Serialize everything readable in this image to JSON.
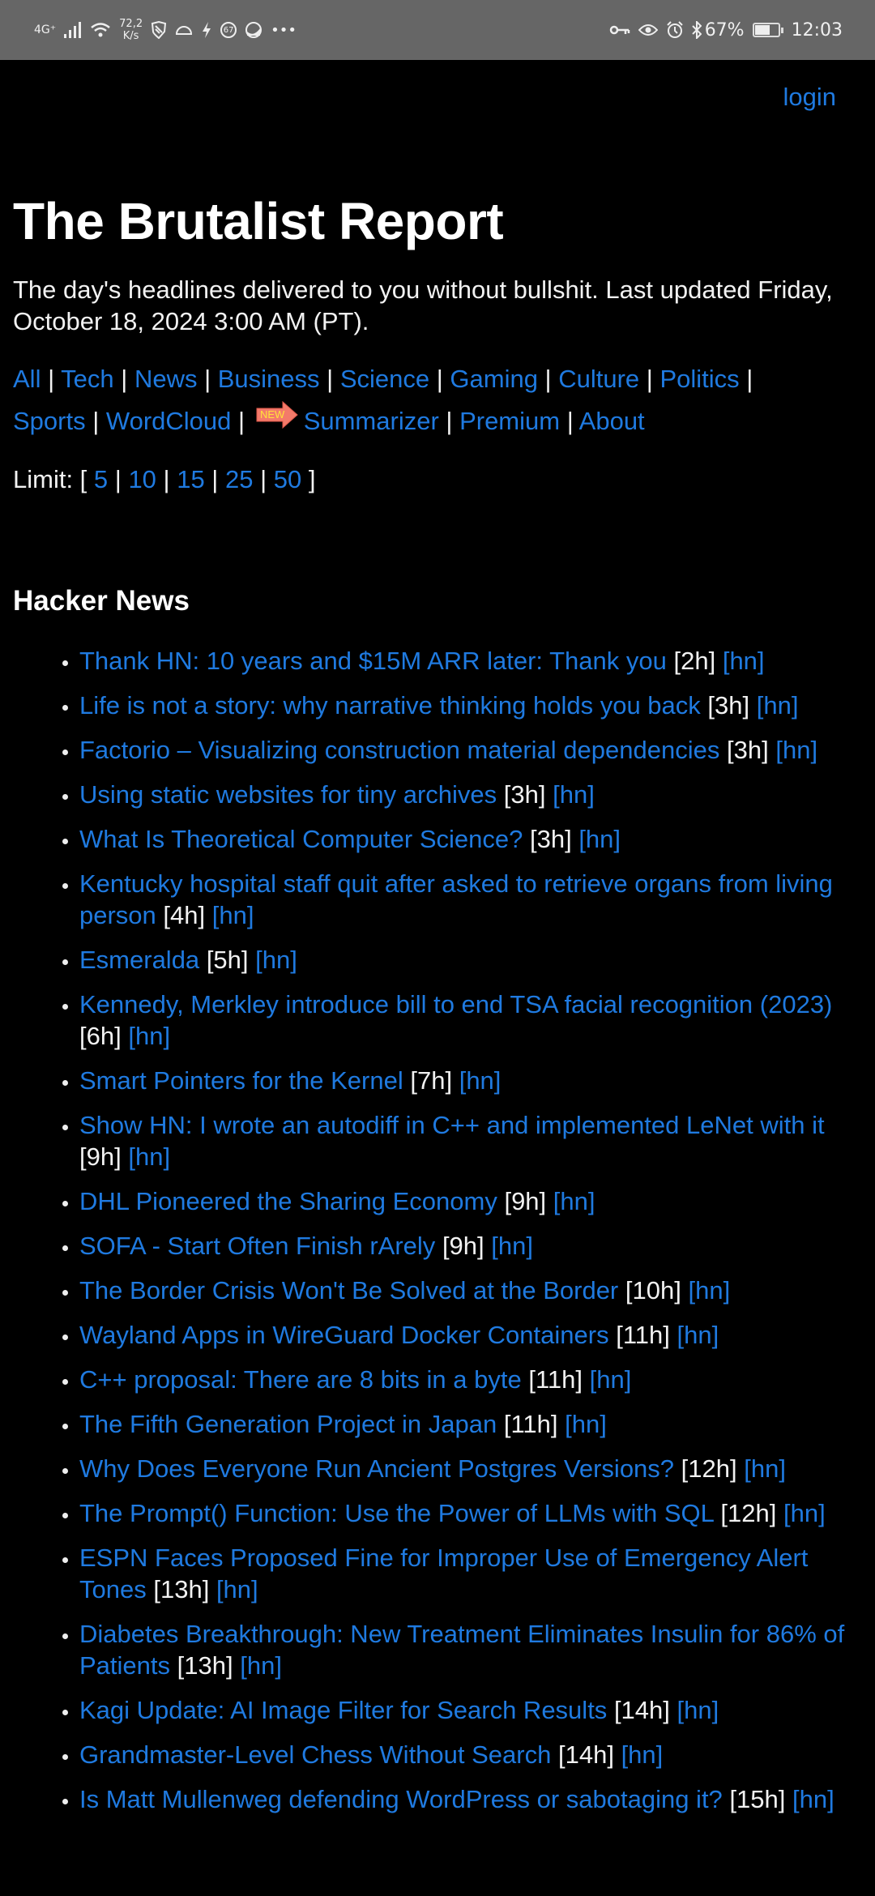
{
  "status_bar": {
    "network": "4G⁺",
    "net_speed_value": "72,2",
    "net_speed_unit": "K/s",
    "notification_badge": "67",
    "battery_percent": "67%",
    "battery_level": 0.67,
    "time": "12:03"
  },
  "header": {
    "login_label": "login",
    "title": "The Brutalist Report",
    "tagline": "The day's headlines delivered to you without bullshit. Last updated Friday, October 18, 2024 3:00 AM (PT)."
  },
  "nav": {
    "items": [
      {
        "label": "All"
      },
      {
        "label": "Tech"
      },
      {
        "label": "News"
      },
      {
        "label": "Business"
      },
      {
        "label": "Science"
      },
      {
        "label": "Gaming"
      },
      {
        "label": "Culture"
      },
      {
        "label": "Politics"
      },
      {
        "label": "Sports"
      },
      {
        "label": "WordCloud"
      },
      {
        "label": "Summarizer",
        "badge": "NEW"
      },
      {
        "label": "Premium"
      },
      {
        "label": "About"
      }
    ],
    "separator": "|"
  },
  "limit": {
    "label": "Limit: [",
    "close": "]",
    "options": [
      "5",
      "10",
      "15",
      "25",
      "50"
    ]
  },
  "section": {
    "title": "Hacker News",
    "source_label": "[hn]",
    "items": [
      {
        "title": "Thank HN: 10 years and $15M ARR later: Thank you",
        "age": "[2h]"
      },
      {
        "title": "Life is not a story: why narrative thinking holds you back",
        "age": "[3h]"
      },
      {
        "title": "Factorio – Visualizing construction material dependencies",
        "age": "[3h]"
      },
      {
        "title": "Using static websites for tiny archives",
        "age": "[3h]"
      },
      {
        "title": "What Is Theoretical Computer Science?",
        "age": "[3h]"
      },
      {
        "title": "Kentucky hospital staff quit after asked to retrieve organs from living person",
        "age": "[4h]"
      },
      {
        "title": "Esmeralda",
        "age": "[5h]"
      },
      {
        "title": "Kennedy, Merkley introduce bill to end TSA facial recognition (2023)",
        "age": "[6h]"
      },
      {
        "title": "Smart Pointers for the Kernel",
        "age": "[7h]"
      },
      {
        "title": "Show HN: I wrote an autodiff in C++ and implemented LeNet with it",
        "age": "[9h]"
      },
      {
        "title": "DHL Pioneered the Sharing Economy",
        "age": "[9h]"
      },
      {
        "title": "SOFA - Start Often Finish rArely",
        "age": "[9h]"
      },
      {
        "title": "The Border Crisis Won't Be Solved at the Border",
        "age": "[10h]"
      },
      {
        "title": "Wayland Apps in WireGuard Docker Containers",
        "age": "[11h]"
      },
      {
        "title": "C++ proposal: There are 8 bits in a byte",
        "age": "[11h]"
      },
      {
        "title": "The Fifth Generation Project in Japan",
        "age": "[11h]"
      },
      {
        "title": "Why Does Everyone Run Ancient Postgres Versions?",
        "age": "[12h]"
      },
      {
        "title": "The Prompt() Function: Use the Power of LLMs with SQL",
        "age": "[12h]"
      },
      {
        "title": "ESPN Faces Proposed Fine for Improper Use of Emergency Alert Tones",
        "age": "[13h]"
      },
      {
        "title": "Diabetes Breakthrough: New Treatment Eliminates Insulin for 86% of Patients",
        "age": "[13h]"
      },
      {
        "title": "Kagi Update: AI Image Filter for Search Results",
        "age": "[14h]"
      },
      {
        "title": "Grandmaster-Level Chess Without Search",
        "age": "[14h]"
      },
      {
        "title": "Is Matt Mullenweg defending WordPress or sabotaging it?",
        "age": "[15h]"
      }
    ]
  },
  "colors": {
    "background": "#000000",
    "link": "#1f7ae0",
    "text": "#f2f2f2",
    "status_bar": "#666666"
  }
}
